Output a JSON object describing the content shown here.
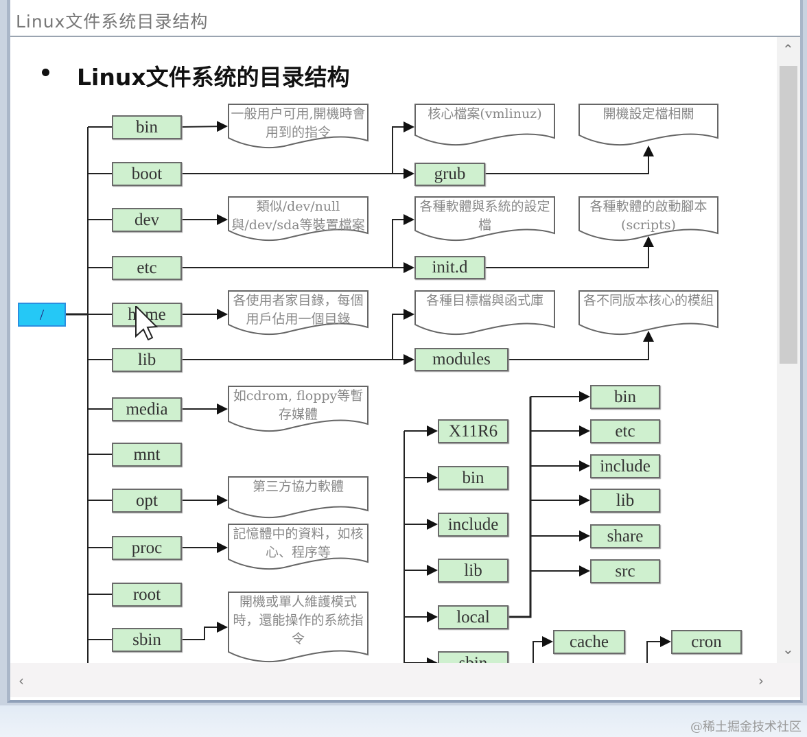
{
  "window": {
    "title": "Linux文件系统目录结构"
  },
  "slide": {
    "heading": "Linux文件系统的目录结构"
  },
  "diagram": {
    "root": "/",
    "dirs": {
      "bin": "bin",
      "boot": "boot",
      "dev": "dev",
      "etc": "etc",
      "home": "home",
      "lib": "lib",
      "media": "media",
      "mnt": "mnt",
      "opt": "opt",
      "proc": "proc",
      "root": "root",
      "sbin": "sbin"
    },
    "subdirs": {
      "grub": "grub",
      "initd": "init.d",
      "modules": "modules"
    },
    "usr_children": {
      "X11R6": "X11R6",
      "bin": "bin",
      "include": "include",
      "lib": "lib",
      "local": "local",
      "sbin": "sbin"
    },
    "local_children": {
      "bin": "bin",
      "etc": "etc",
      "include": "include",
      "lib": "lib",
      "share": "share",
      "src": "src"
    },
    "var_children": {
      "cache": "cache",
      "cron": "cron"
    },
    "notes": {
      "bin": "一般用户可用,開機時會用到的指令",
      "dev": "類似/dev/null與/dev/sda等裝置檔案",
      "home": "各使用者家目錄，每個用戶佔用一個目錄",
      "media": "如cdrom, floppy等暫存媒體",
      "opt": "第三方協力軟體",
      "proc": "記憶體中的資料，如核心、程序等",
      "sbin": "開機或單人維護模式時，還能操作的系統指令",
      "boot_kernel": "核心檔案(vmlinuz)",
      "grub": "開機設定檔相關",
      "etc": "各種軟體與系統的設定檔",
      "initd": "各種軟體的啟動腳本(scripts)",
      "lib": "各種目標檔與函式庫",
      "modules": "各不同版本核心的模組"
    }
  },
  "scrollbars": {
    "up": "⌃",
    "down": "⌄",
    "left": "‹",
    "right": "›"
  },
  "watermark": "@稀土掘金技术社区",
  "colors": {
    "dir_fill": "#cff0cf",
    "root_fill": "#25c8f6",
    "note_border": "#666666"
  }
}
